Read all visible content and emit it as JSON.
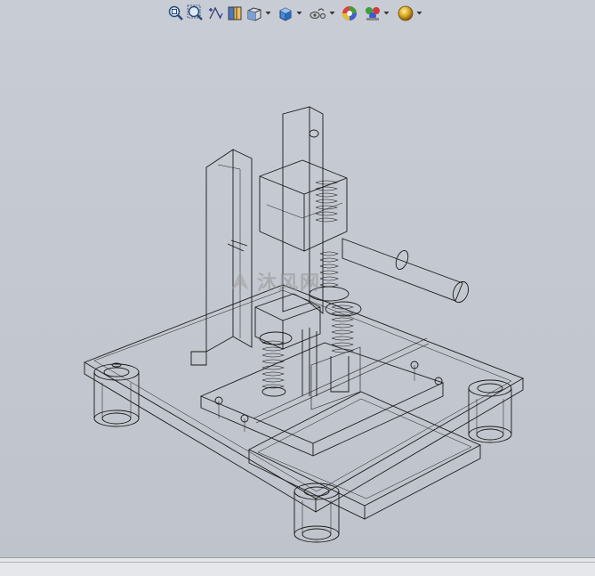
{
  "viewport": {
    "background": "#c4c8d0",
    "line_color": "#1a1a1a"
  },
  "toolbar": {
    "buttons": [
      {
        "icon": "zoom-to-fit-icon",
        "has_dropdown": false
      },
      {
        "icon": "zoom-to-area-icon",
        "has_dropdown": false
      },
      {
        "icon": "previous-view-icon",
        "has_dropdown": false
      },
      {
        "icon": "section-view-icon",
        "has_dropdown": false
      },
      {
        "icon": "view-orientation-icon",
        "has_dropdown": true
      },
      {
        "icon": "display-style-icon",
        "has_dropdown": true
      },
      {
        "icon": "hide-show-items-icon",
        "has_dropdown": true
      },
      {
        "icon": "edit-appearance-icon",
        "has_dropdown": false
      },
      {
        "icon": "apply-scene-icon",
        "has_dropdown": true
      },
      {
        "icon": "view-settings-icon",
        "has_dropdown": true
      }
    ]
  },
  "watermark": {
    "text": "沐风网"
  }
}
